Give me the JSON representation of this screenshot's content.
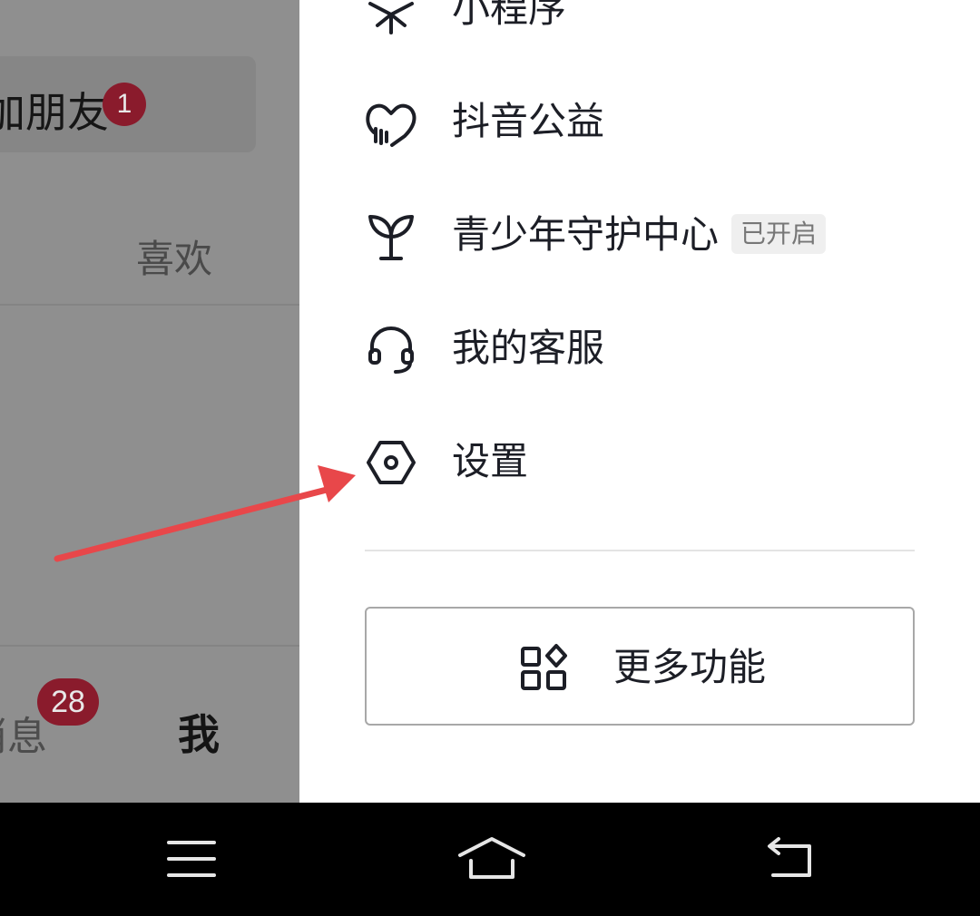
{
  "background_app": {
    "friend_card_label": "加朋友",
    "friend_badge": "1",
    "likes_tab": "喜欢",
    "nav_messages": "消息",
    "messages_badge": "28",
    "nav_me": "我"
  },
  "drawer": {
    "items": [
      {
        "label": "小程序",
        "icon": "mini-program-icon"
      },
      {
        "label": "抖音公益",
        "icon": "charity-heart-icon"
      },
      {
        "label": "青少年守护中心",
        "icon": "sprout-icon",
        "status": "已开启"
      },
      {
        "label": "我的客服",
        "icon": "headset-icon"
      },
      {
        "label": "设置",
        "icon": "settings-hexagon-icon"
      }
    ],
    "more_button": {
      "label": "更多功能",
      "icon": "apps-grid-icon"
    }
  },
  "annotation": {
    "color": "#e8474a",
    "points_to": "设置"
  },
  "system_nav": [
    "menu-icon",
    "home-icon",
    "back-icon"
  ],
  "colors": {
    "badge": "#8a1b2c",
    "text": "#1c1e26",
    "overlay": "#8f8f8f"
  }
}
